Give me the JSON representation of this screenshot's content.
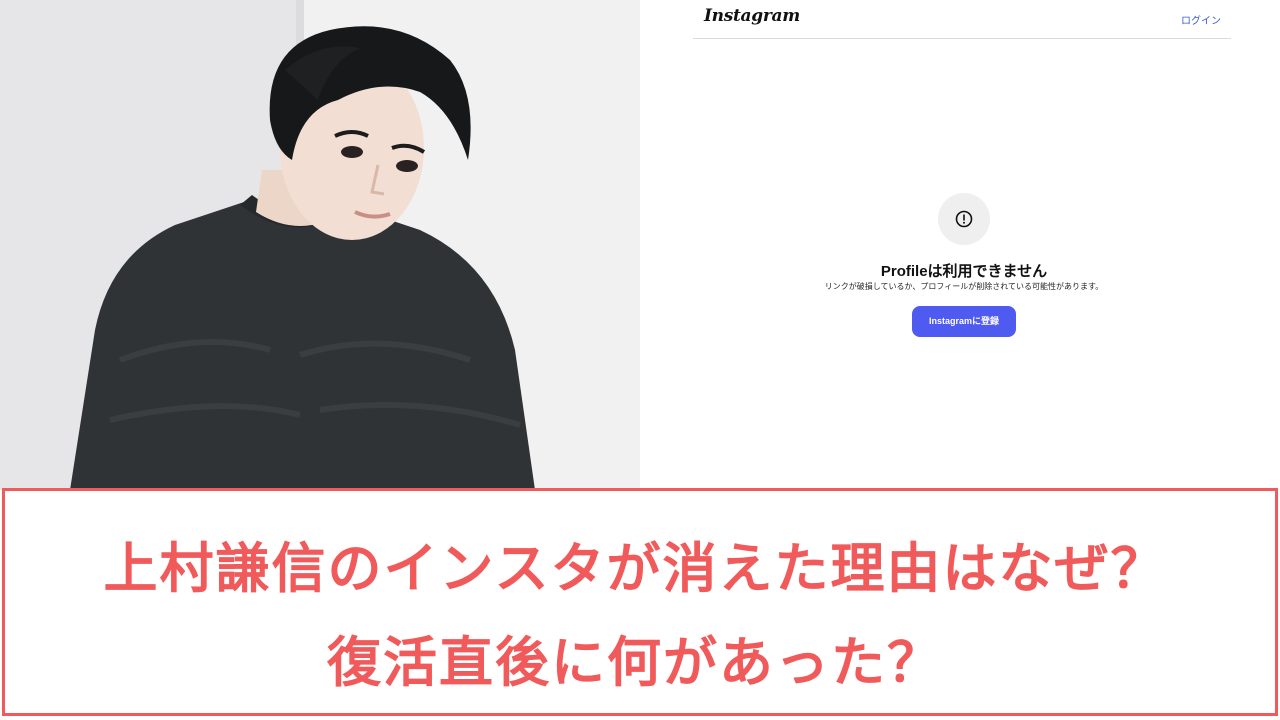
{
  "instagram": {
    "logo": "Instagram",
    "login_link": "ログイン",
    "alert_icon": "exclamation-circle-icon",
    "title": "Profileは利用できません",
    "subtitle": "リンクが破損しているか、プロフィールが削除されている可能性があります。",
    "signup_button": "Instagramに登録"
  },
  "caption": {
    "line1": "上村謙信のインスタが消えた理由はなぜ？",
    "line2": "復活直後に何があった？"
  },
  "colors": {
    "accent_red": "#f15a5a",
    "ig_button_blue": "#4f5af0",
    "ig_link_blue": "#3b5bdb",
    "sweater": "#2d3133"
  }
}
